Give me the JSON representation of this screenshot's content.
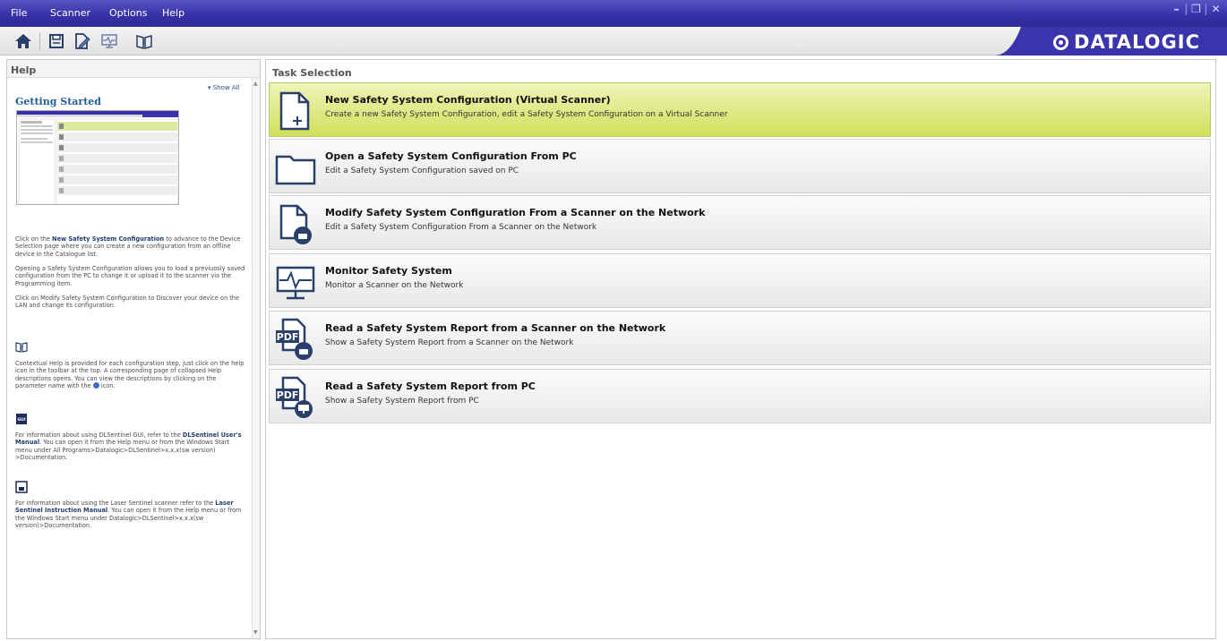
{
  "window": {
    "menu": [
      "File",
      "Scanner",
      "Options",
      "Help"
    ],
    "controls": [
      "–",
      "❐",
      "✕"
    ]
  },
  "toolbar": {
    "icons": [
      "home-icon",
      "save-icon",
      "edit-icon",
      "monitor-icon",
      "help-book-icon"
    ],
    "logo": "DATALOGIC"
  },
  "help": {
    "panel_title": "Help",
    "show_all": "▾ Show All",
    "getting_started": "Getting Started",
    "p1_prefix": "Click on the ",
    "p1_bold": "New Safety System Configuration",
    "p1_suffix": " to advance to the Device Selection page where you can create a new configuration from an offline device in the Catalogue list.",
    "p2": "Opening a Safety System Configuration allows you to load a previuosly saved configuration from the PC to change it or upload it to the scanner via the Programming item.",
    "p3": "Click on Modify Safety System Configuration to Discover your device on the LAN and change its configuration.",
    "p4_prefix": "Contextual Help is provided for each configuration step, just click on the help icon in the toolbar at the top. A corresponding page of collapsed Help descriptions opens. You can view the descriptions by clicking on the parameter name with the ",
    "p4_suffix": " icon.",
    "p5_prefix": "For information about using DLSentinel GUI, refer to the ",
    "p5_bold": "DLSentinel User's Manual",
    "p5_suffix": ". You can open it from the Help menu or from the Windows Start menu under All Programs>Datalogic>DLSentinel>x.x.x(sw version) >Documentation.",
    "p6_prefix": "For information about using the Laser Sentinel scanner refer to the ",
    "p6_bold": "Laser Sentinel Instruction Manual",
    "p6_suffix": ". You can open it from the Help menu or from the Windows Start menu under Datalogic>DLSentinel>x.x.x(sw version)>Documentation."
  },
  "tasks": {
    "panel_title": "Task Selection",
    "items": [
      {
        "title": "New Safety System Configuration (Virtual Scanner)",
        "desc": "Create a new Safety System Configuration, edit a Safety System Configuration on a Virtual Scanner",
        "icon": "new-file-icon",
        "selected": true
      },
      {
        "title": "Open a Safety System Configuration From PC",
        "desc": "Edit a Safety System Configuration saved on PC",
        "icon": "folder-icon",
        "selected": false
      },
      {
        "title": "Modify Safety System Configuration From a Scanner on the Network",
        "desc": "Edit a Safety System Configuration From a Scanner on the Network",
        "icon": "scanner-file-icon",
        "selected": false
      },
      {
        "title": "Monitor Safety System",
        "desc": "Monitor a Scanner on the Network",
        "icon": "monitor-icon",
        "selected": false
      },
      {
        "title": "Read a Safety System Report from a Scanner on the Network",
        "desc": "Show a Safety System Report from a Scanner on the Network",
        "icon": "pdf-scanner-icon",
        "selected": false
      },
      {
        "title": "Read a Safety System Report from PC",
        "desc": "Show a Safety System Report from PC",
        "icon": "pdf-pc-icon",
        "selected": false
      }
    ]
  },
  "colors": {
    "menubar": "#3832a8",
    "logo_bg": "#3b35ad",
    "selected_task": "#cfe05a",
    "link_blue": "#1f5c99"
  }
}
